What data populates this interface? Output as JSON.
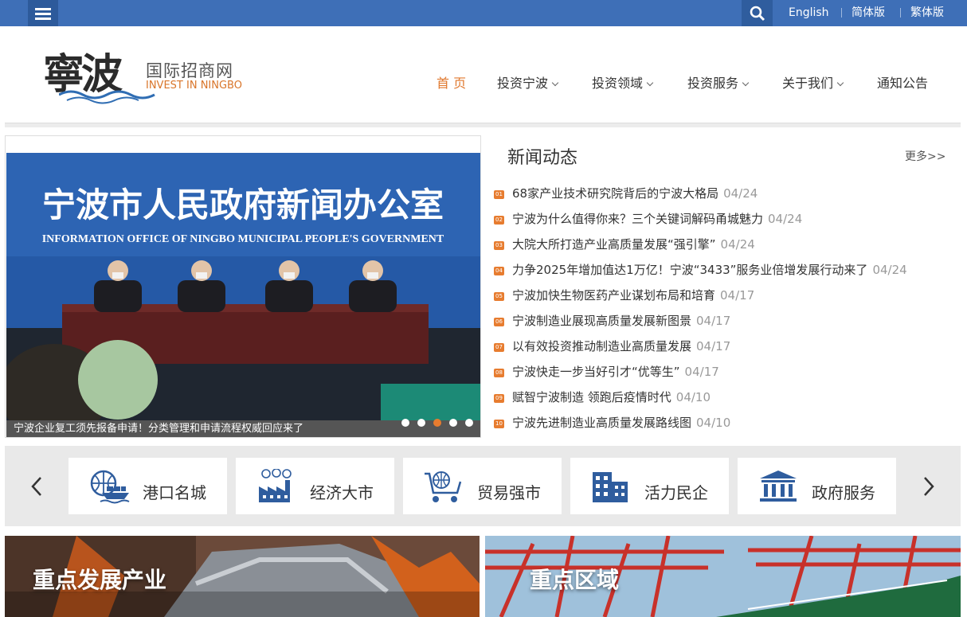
{
  "topbar": {
    "lang_english": "English",
    "lang_simplified": "简体版",
    "lang_traditional": "繁体版"
  },
  "logo": {
    "title": "國際招商網",
    "title_cn": "国际招商网",
    "subtitle_pre": "INVEST IN ",
    "subtitle_em": "NINGBO",
    "mark": "寧波"
  },
  "nav": {
    "home": "首 页",
    "invest_ningbo": "投资宁波",
    "invest_fields": "投资领域",
    "invest_services": "投资服务",
    "about_us": "关于我们",
    "notices": "通知公告"
  },
  "slider": {
    "banner_cn": "宁波市人民政府新闻办公室",
    "banner_en": "INFORMATION OFFICE OF NINGBO MUNICIPAL PEOPLE'S GOVERNMENT",
    "caption": "宁波企业复工须先报备申请！分类管理和申请流程权威回应来了",
    "active_dot": 3
  },
  "news": {
    "title": "新闻动态",
    "more": "更多>>",
    "items": [
      {
        "badge": "01",
        "text": "68家产业技术研究院背后的宁波大格局",
        "date": "04/24"
      },
      {
        "badge": "02",
        "text": "宁波为什么值得你来？三个关键词解码甬城魅力",
        "date": "04/24"
      },
      {
        "badge": "03",
        "text": "大院大所打造产业高质量发展“强引擎”",
        "date": "04/24"
      },
      {
        "badge": "04",
        "text": "力争2025年增加值达1万亿！宁波“3433”服务业倍增发展行动来了",
        "date": "04/24"
      },
      {
        "badge": "05",
        "text": "宁波加快生物医药产业谋划布局和培育",
        "date": "04/17"
      },
      {
        "badge": "06",
        "text": "宁波制造业展现高质量发展新图景",
        "date": "04/17"
      },
      {
        "badge": "07",
        "text": "以有效投资推动制造业高质量发展",
        "date": "04/17"
      },
      {
        "badge": "08",
        "text": "宁波快走一步当好引才“优等生”",
        "date": "04/17"
      },
      {
        "badge": "09",
        "text": "赋智宁波制造 领跑后疫情时代",
        "date": "04/10"
      },
      {
        "badge": "10",
        "text": "宁波先进制造业高质量发展路线图",
        "date": "04/10"
      }
    ]
  },
  "categories": [
    {
      "label": "港口名城",
      "icon": "port-ship-icon"
    },
    {
      "label": "经济大市",
      "icon": "factory-money-icon"
    },
    {
      "label": "贸易强市",
      "icon": "shopping-cart-icon"
    },
    {
      "label": "活力民企",
      "icon": "office-building-icon"
    },
    {
      "label": "政府服务",
      "icon": "government-building-icon"
    }
  ],
  "banners": {
    "industry": "重点发展产业",
    "zones": "重点区域"
  },
  "colors": {
    "topbar": "#3e6fb7",
    "accent": "#e77c2f",
    "icon_blue": "#2f5d9e"
  }
}
